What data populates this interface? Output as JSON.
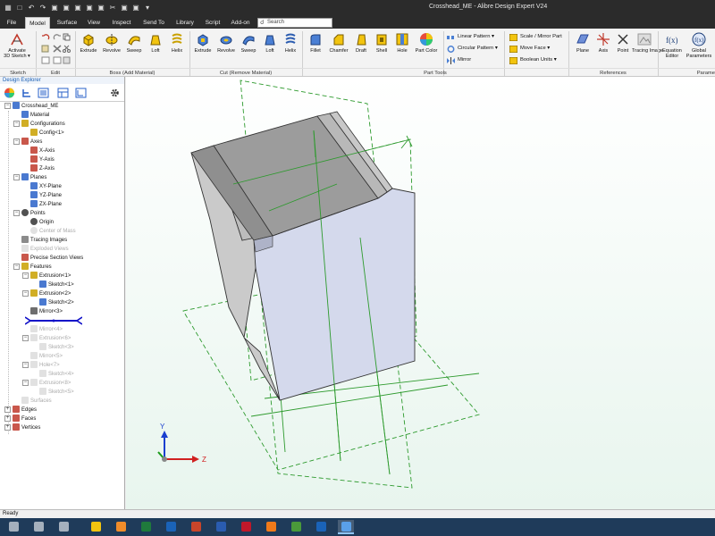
{
  "window": {
    "title": "Crosshead_ME - Alibre Design Expert V24"
  },
  "menu": {
    "tabs": [
      "File",
      "Model",
      "Surface",
      "View",
      "Inspect",
      "Send To",
      "Library",
      "Script",
      "Add-on"
    ],
    "active": "Model",
    "search_placeholder": "Search"
  },
  "ribbon": {
    "sketch_btn": [
      "Activate",
      "3D Sketch ▾"
    ],
    "boss": [
      "Extrude",
      "Revolve",
      "Sweep",
      "Loft",
      "Helix"
    ],
    "cut": [
      "Extrude",
      "Revolve",
      "Sweep",
      "Loft",
      "Helix"
    ],
    "part_tools": [
      "Fillet",
      "Chamfer",
      "Draft",
      "Shell",
      "Hole",
      "Part Color"
    ],
    "pattern": [
      "Linear Pattern ▾",
      "Circular Pattern ▾",
      "Mirror"
    ],
    "scale": [
      "Scale / Mirror Part",
      "Move Face ▾",
      "Boolean Units ▾"
    ],
    "refs": [
      "Plane",
      "Axis",
      "Point",
      "Tracing Image"
    ],
    "eq": [
      [
        "Equation",
        "Editor"
      ],
      [
        "Global",
        "Parameters"
      ]
    ],
    "groups": [
      "Sketch",
      "Edit",
      "Boss (Add Material)",
      "Cut (Remove Material)",
      "Part Tools",
      "References",
      "Parame"
    ]
  },
  "explorer": {
    "header": "Design Explorer",
    "tree": [
      {
        "label": "Crosshead_ME",
        "depth": 0,
        "toggle": "−",
        "icon": "part",
        "dim": false
      },
      {
        "label": "Material",
        "depth": 1,
        "toggle": "",
        "icon": "material",
        "dim": false
      },
      {
        "label": "Configurations",
        "depth": 1,
        "toggle": "−",
        "icon": "config",
        "dim": false
      },
      {
        "label": "Config<1>",
        "depth": 2,
        "toggle": "",
        "icon": "config",
        "dim": false
      },
      {
        "label": "Axes",
        "depth": 1,
        "toggle": "−",
        "icon": "axis",
        "dim": false
      },
      {
        "label": "X-Axis",
        "depth": 2,
        "toggle": "",
        "icon": "axis",
        "dim": false
      },
      {
        "label": "Y-Axis",
        "depth": 2,
        "toggle": "",
        "icon": "axis",
        "dim": false
      },
      {
        "label": "Z-Axis",
        "depth": 2,
        "toggle": "",
        "icon": "axis",
        "dim": false
      },
      {
        "label": "Planes",
        "depth": 1,
        "toggle": "−",
        "icon": "plane",
        "dim": false
      },
      {
        "label": "XY-Plane",
        "depth": 2,
        "toggle": "",
        "icon": "plane",
        "dim": false
      },
      {
        "label": "YZ-Plane",
        "depth": 2,
        "toggle": "",
        "icon": "plane",
        "dim": false
      },
      {
        "label": "ZX-Plane",
        "depth": 2,
        "toggle": "",
        "icon": "plane",
        "dim": false
      },
      {
        "label": "Points",
        "depth": 1,
        "toggle": "−",
        "icon": "point",
        "dim": false
      },
      {
        "label": "Origin",
        "depth": 2,
        "toggle": "",
        "icon": "point",
        "dim": false
      },
      {
        "label": "Center of Mass",
        "depth": 2,
        "toggle": "",
        "icon": "point",
        "dim": true
      },
      {
        "label": "Tracing Images",
        "depth": 1,
        "toggle": "",
        "icon": "image",
        "dim": false
      },
      {
        "label": "Exploded Views",
        "depth": 1,
        "toggle": "",
        "icon": "image",
        "dim": true
      },
      {
        "label": "Precise Section Views",
        "depth": 1,
        "toggle": "",
        "icon": "section",
        "dim": false
      },
      {
        "label": "Features",
        "depth": 1,
        "toggle": "−",
        "icon": "features",
        "dim": false
      },
      {
        "label": "Extrusion<1>",
        "depth": 2,
        "toggle": "−",
        "icon": "extrude",
        "dim": false
      },
      {
        "label": "Sketch<1>",
        "depth": 3,
        "toggle": "",
        "icon": "sketch",
        "dim": false
      },
      {
        "label": "Extrusion<2>",
        "depth": 2,
        "toggle": "−",
        "icon": "extrude",
        "dim": false
      },
      {
        "label": "Sketch<2>",
        "depth": 3,
        "toggle": "",
        "icon": "sketch",
        "dim": false
      },
      {
        "label": "Mirror<3>",
        "depth": 2,
        "toggle": "",
        "icon": "mirror",
        "dim": false
      },
      {
        "label": "",
        "depth": 2,
        "toggle": "",
        "icon": "rollback",
        "dim": false
      },
      {
        "label": "Mirror<4>",
        "depth": 2,
        "toggle": "",
        "icon": "mirror",
        "dim": true
      },
      {
        "label": "Extrusion<6>",
        "depth": 2,
        "toggle": "−",
        "icon": "extrude",
        "dim": true
      },
      {
        "label": "Sketch<3>",
        "depth": 3,
        "toggle": "",
        "icon": "sketch",
        "dim": true
      },
      {
        "label": "Mirror<5>",
        "depth": 2,
        "toggle": "",
        "icon": "mirror",
        "dim": true
      },
      {
        "label": "Hole<7>",
        "depth": 2,
        "toggle": "−",
        "icon": "hole",
        "dim": true
      },
      {
        "label": "Sketch<4>",
        "depth": 3,
        "toggle": "",
        "icon": "sketch",
        "dim": true
      },
      {
        "label": "Extrusion<8>",
        "depth": 2,
        "toggle": "−",
        "icon": "extrude",
        "dim": true
      },
      {
        "label": "Sketch<5>",
        "depth": 3,
        "toggle": "",
        "icon": "sketch",
        "dim": true
      },
      {
        "label": "Surfaces",
        "depth": 1,
        "toggle": "",
        "icon": "surface",
        "dim": true
      },
      {
        "label": "Edges",
        "depth": 0,
        "toggle": "+",
        "icon": "edges",
        "dim": false
      },
      {
        "label": "Faces",
        "depth": 0,
        "toggle": "+",
        "icon": "faces",
        "dim": false
      },
      {
        "label": "Vertices",
        "depth": 0,
        "toggle": "+",
        "icon": "vertices",
        "dim": false
      }
    ]
  },
  "triad": {
    "x": "Z",
    "y": "Y",
    "z": "X"
  },
  "status": "Ready",
  "colors": {
    "titlebar": "#2b2b2b",
    "accent": "#1a5fb4",
    "face_front": "#d4d9ec",
    "face_top": "#9c9c9c",
    "face_side": "#cacaca",
    "plane": "#2d9a2d",
    "rollback": "#1010c8",
    "taskbar": "#1f3b5a"
  },
  "taskbar_apps": [
    "start",
    "search",
    "task-view",
    "explorer",
    "media",
    "excel",
    "outlook",
    "powerpoint",
    "word",
    "acrobat",
    "firefox",
    "chrome",
    "outlook2",
    "alibre"
  ]
}
